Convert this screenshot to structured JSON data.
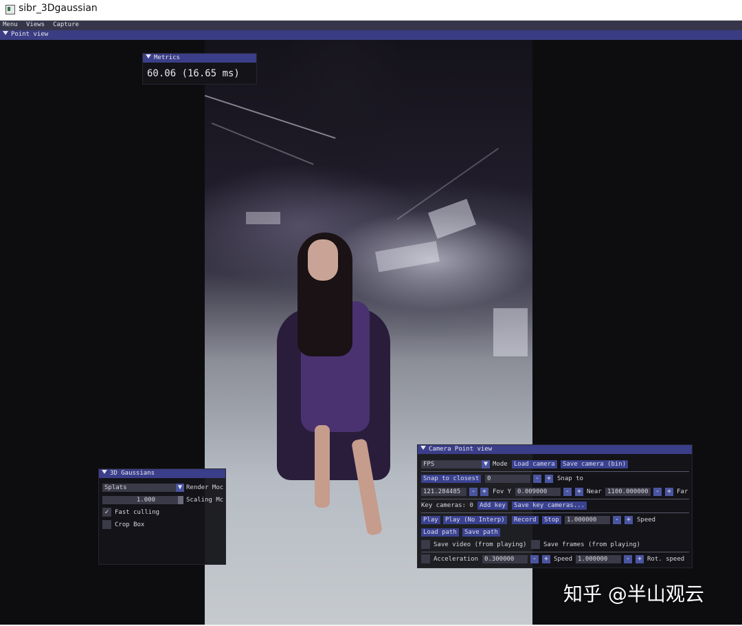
{
  "window": {
    "title": "sibr_3Dgaussian",
    "app_icon": "app-window-icon"
  },
  "menubar": {
    "items": [
      "Menu",
      "Views",
      "Capture"
    ]
  },
  "view_header": {
    "label": "Point view"
  },
  "metrics": {
    "title": "Metrics",
    "fps_text": "60.06 (16.65 ms)"
  },
  "gaussians": {
    "title": "3D Gaussians",
    "render_mode_value": "Splats",
    "render_mode_label": "Render Moc",
    "scaling_value": "1.000",
    "scaling_label": "Scaling Mc",
    "fast_culling_label": "Fast culling",
    "fast_culling_checked": true,
    "crop_box_label": "Crop Box",
    "crop_box_checked": false
  },
  "camera": {
    "title": "Camera Point view",
    "mode_value": "FPS",
    "mode_label": "Mode",
    "load_camera": "Load camera",
    "save_camera": "Save camera (bin)",
    "snap_to_closest": "Snap to closest",
    "snap_value": "0",
    "snap_to_label": "Snap to",
    "fov_value": "121.284485",
    "fov_label": "Fov Y",
    "near_value": "0.009000",
    "near_label": "Near",
    "far_value": "1100.000000",
    "far_label": "Far",
    "key_cameras_label": "Key cameras: 0",
    "add_key": "Add key",
    "save_key_cameras": "Save key cameras...",
    "play": "Play",
    "play_no_interp": "Play (No Interp)",
    "record": "Record",
    "stop": "Stop",
    "speed_value": "1.000000",
    "speed_label": "Speed",
    "load_path": "Load path",
    "save_path": "Save path",
    "save_video": "Save video (from playing)",
    "save_frames": "Save frames (from playing)",
    "acceleration_label": "Acceleration",
    "acceleration_value": "0.300000",
    "speed2_label": "Speed",
    "speed2_value": "1.000000",
    "rot_speed_label": "Rot. speed",
    "minus": "-",
    "plus": "+"
  },
  "watermark": {
    "text": "知乎 @半山观云"
  },
  "colors": {
    "header_blue": "#3b3e88",
    "button_blue": "#3a4290",
    "panel_bg": "#141418",
    "menubar": "#36364a"
  }
}
